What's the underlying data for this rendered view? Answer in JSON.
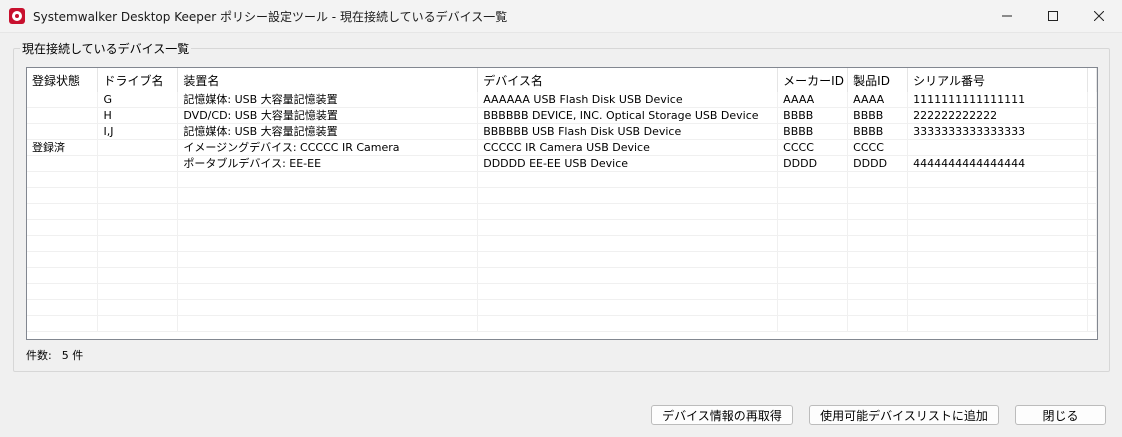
{
  "window": {
    "title": "Systemwalker Desktop Keeper ポリシー設定ツール - 現在接続しているデバイス一覧"
  },
  "group": {
    "label": "現在接続しているデバイス一覧"
  },
  "table": {
    "columns": [
      "登録状態",
      "ドライブ名",
      "装置名",
      "デバイス名",
      "メーカーID",
      "製品ID",
      "シリアル番号"
    ],
    "rows": [
      [
        "",
        "G",
        "記憶媒体: USB 大容量記憶装置",
        "AAAAAA USB Flash Disk USB Device",
        "AAAA",
        "AAAA",
        "1111111111111111"
      ],
      [
        "",
        "H",
        "DVD/CD: USB 大容量記憶装置",
        "BBBBBB DEVICE, INC. Optical Storage USB Device",
        "BBBB",
        "BBBB",
        "222222222222"
      ],
      [
        "",
        "I,J",
        "記憶媒体: USB 大容量記憶装置",
        "BBBBBB USB Flash Disk USB Device",
        "BBBB",
        "BBBB",
        "3333333333333333"
      ],
      [
        "登録済",
        "",
        "イメージングデバイス: CCCCC IR Camera",
        "CCCCC IR Camera USB Device",
        "CCCC",
        "CCCC",
        ""
      ],
      [
        "",
        "",
        "ポータブルデバイス: EE-EE",
        "DDDDD EE-EE USB Device",
        "DDDD",
        "DDDD",
        "4444444444444444"
      ]
    ]
  },
  "count": {
    "label": "件数:",
    "value": "5 件"
  },
  "buttons": {
    "refresh": "デバイス情報の再取得",
    "add": "使用可能デバイスリストに追加",
    "close": "閉じる"
  }
}
